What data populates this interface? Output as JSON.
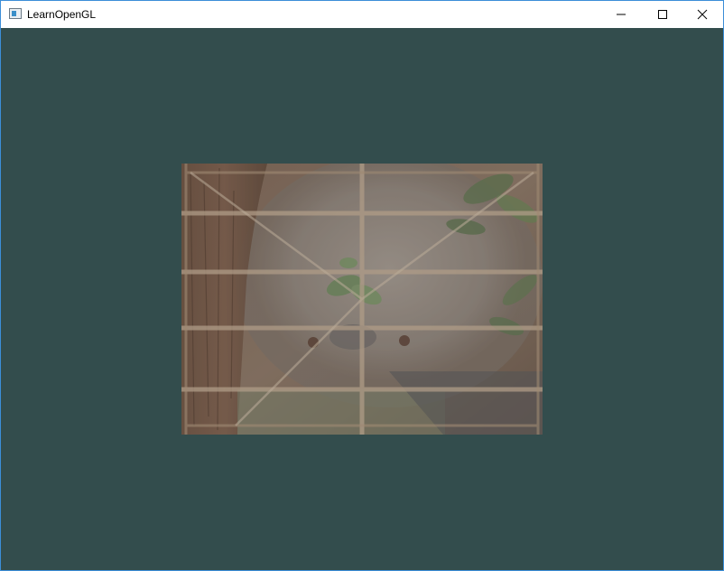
{
  "window": {
    "title": "LearnOpenGL",
    "border_color": "#3c8ed8"
  },
  "titlebar": {
    "icon": "window-app-icon",
    "controls": [
      "minimize-icon",
      "maximize-icon",
      "close-icon"
    ]
  },
  "viewport": {
    "clear_color": "#334d4d",
    "content": "textured-quad"
  }
}
